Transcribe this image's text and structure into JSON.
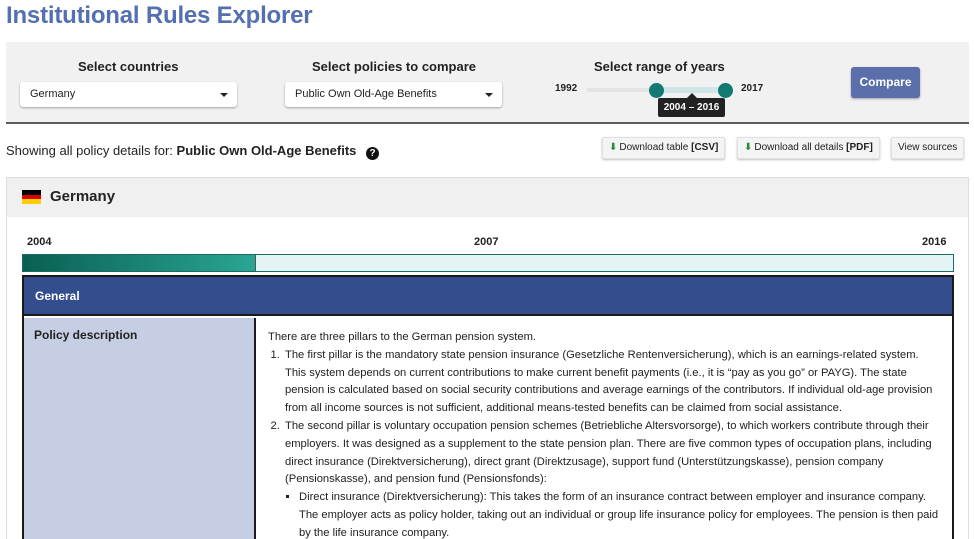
{
  "app": {
    "title": "Institutional Rules Explorer"
  },
  "controls": {
    "countries": {
      "label": "Select countries",
      "selected": "Germany"
    },
    "policies": {
      "label": "Select policies to compare",
      "selected": "Public Own Old-Age Benefits"
    },
    "years": {
      "label": "Select range of years",
      "min": "1992",
      "max": "2017",
      "range_text": "2004 – 2016",
      "selected_start": 2004,
      "selected_end": 2016
    },
    "compare_label": "Compare"
  },
  "summary": {
    "prefix": "Showing all policy details for:",
    "policy": "Public Own Old-Age Benefits",
    "help_icon": "question-circle-icon"
  },
  "downloads": {
    "table_label": "Download table ",
    "table_format": "[CSV]",
    "all_label": "Download all details ",
    "all_format": "[PDF]",
    "sources_label": "View sources",
    "icon": "download-icon"
  },
  "country": {
    "name": "Germany",
    "flag_colors": [
      "#000000",
      "#dd0000",
      "#ffce00"
    ],
    "timeline": {
      "start": "2004",
      "mid": "2007",
      "end": "2016",
      "filled_fraction": 0.25
    },
    "sections": [
      {
        "title": "General",
        "rows": [
          {
            "label": "Policy description",
            "intro": "There are three pillars to the German pension system.",
            "items": [
              "The first pillar is the mandatory state pension insurance (Gesetzliche Rentenversicherung), which is an earnings-related system. This system depends on current contributions to make current benefit payments (i.e., it is “pay as you go” or PAYG). The state pension is calculated based on social security contributions and average earnings of the contributors. If individual old-age provision from all income sources is not sufficient, additional means-tested benefits can be claimed from social assistance.",
              "The second pillar is voluntary occupation pension schemes (Betriebliche Altersvorsorge), to which workers contribute through their employers. It was designed as a supplement to the state pension plan. There are five common types of occupation plans, including direct insurance (Direktversicherung), direct grant (Direktzusage), support fund (Unterstützungskasse), pension company (Pensionskasse), and pension fund (Pensionsfonds):"
            ],
            "subitems": [
              "Direct insurance (Direktversicherung): This takes the form of an insurance contract between employer and insurance company. The employer acts as policy holder, taking out an individual or group life insurance policy for employees. The pension is then paid by the life insurance company."
            ]
          }
        ]
      }
    ]
  }
}
